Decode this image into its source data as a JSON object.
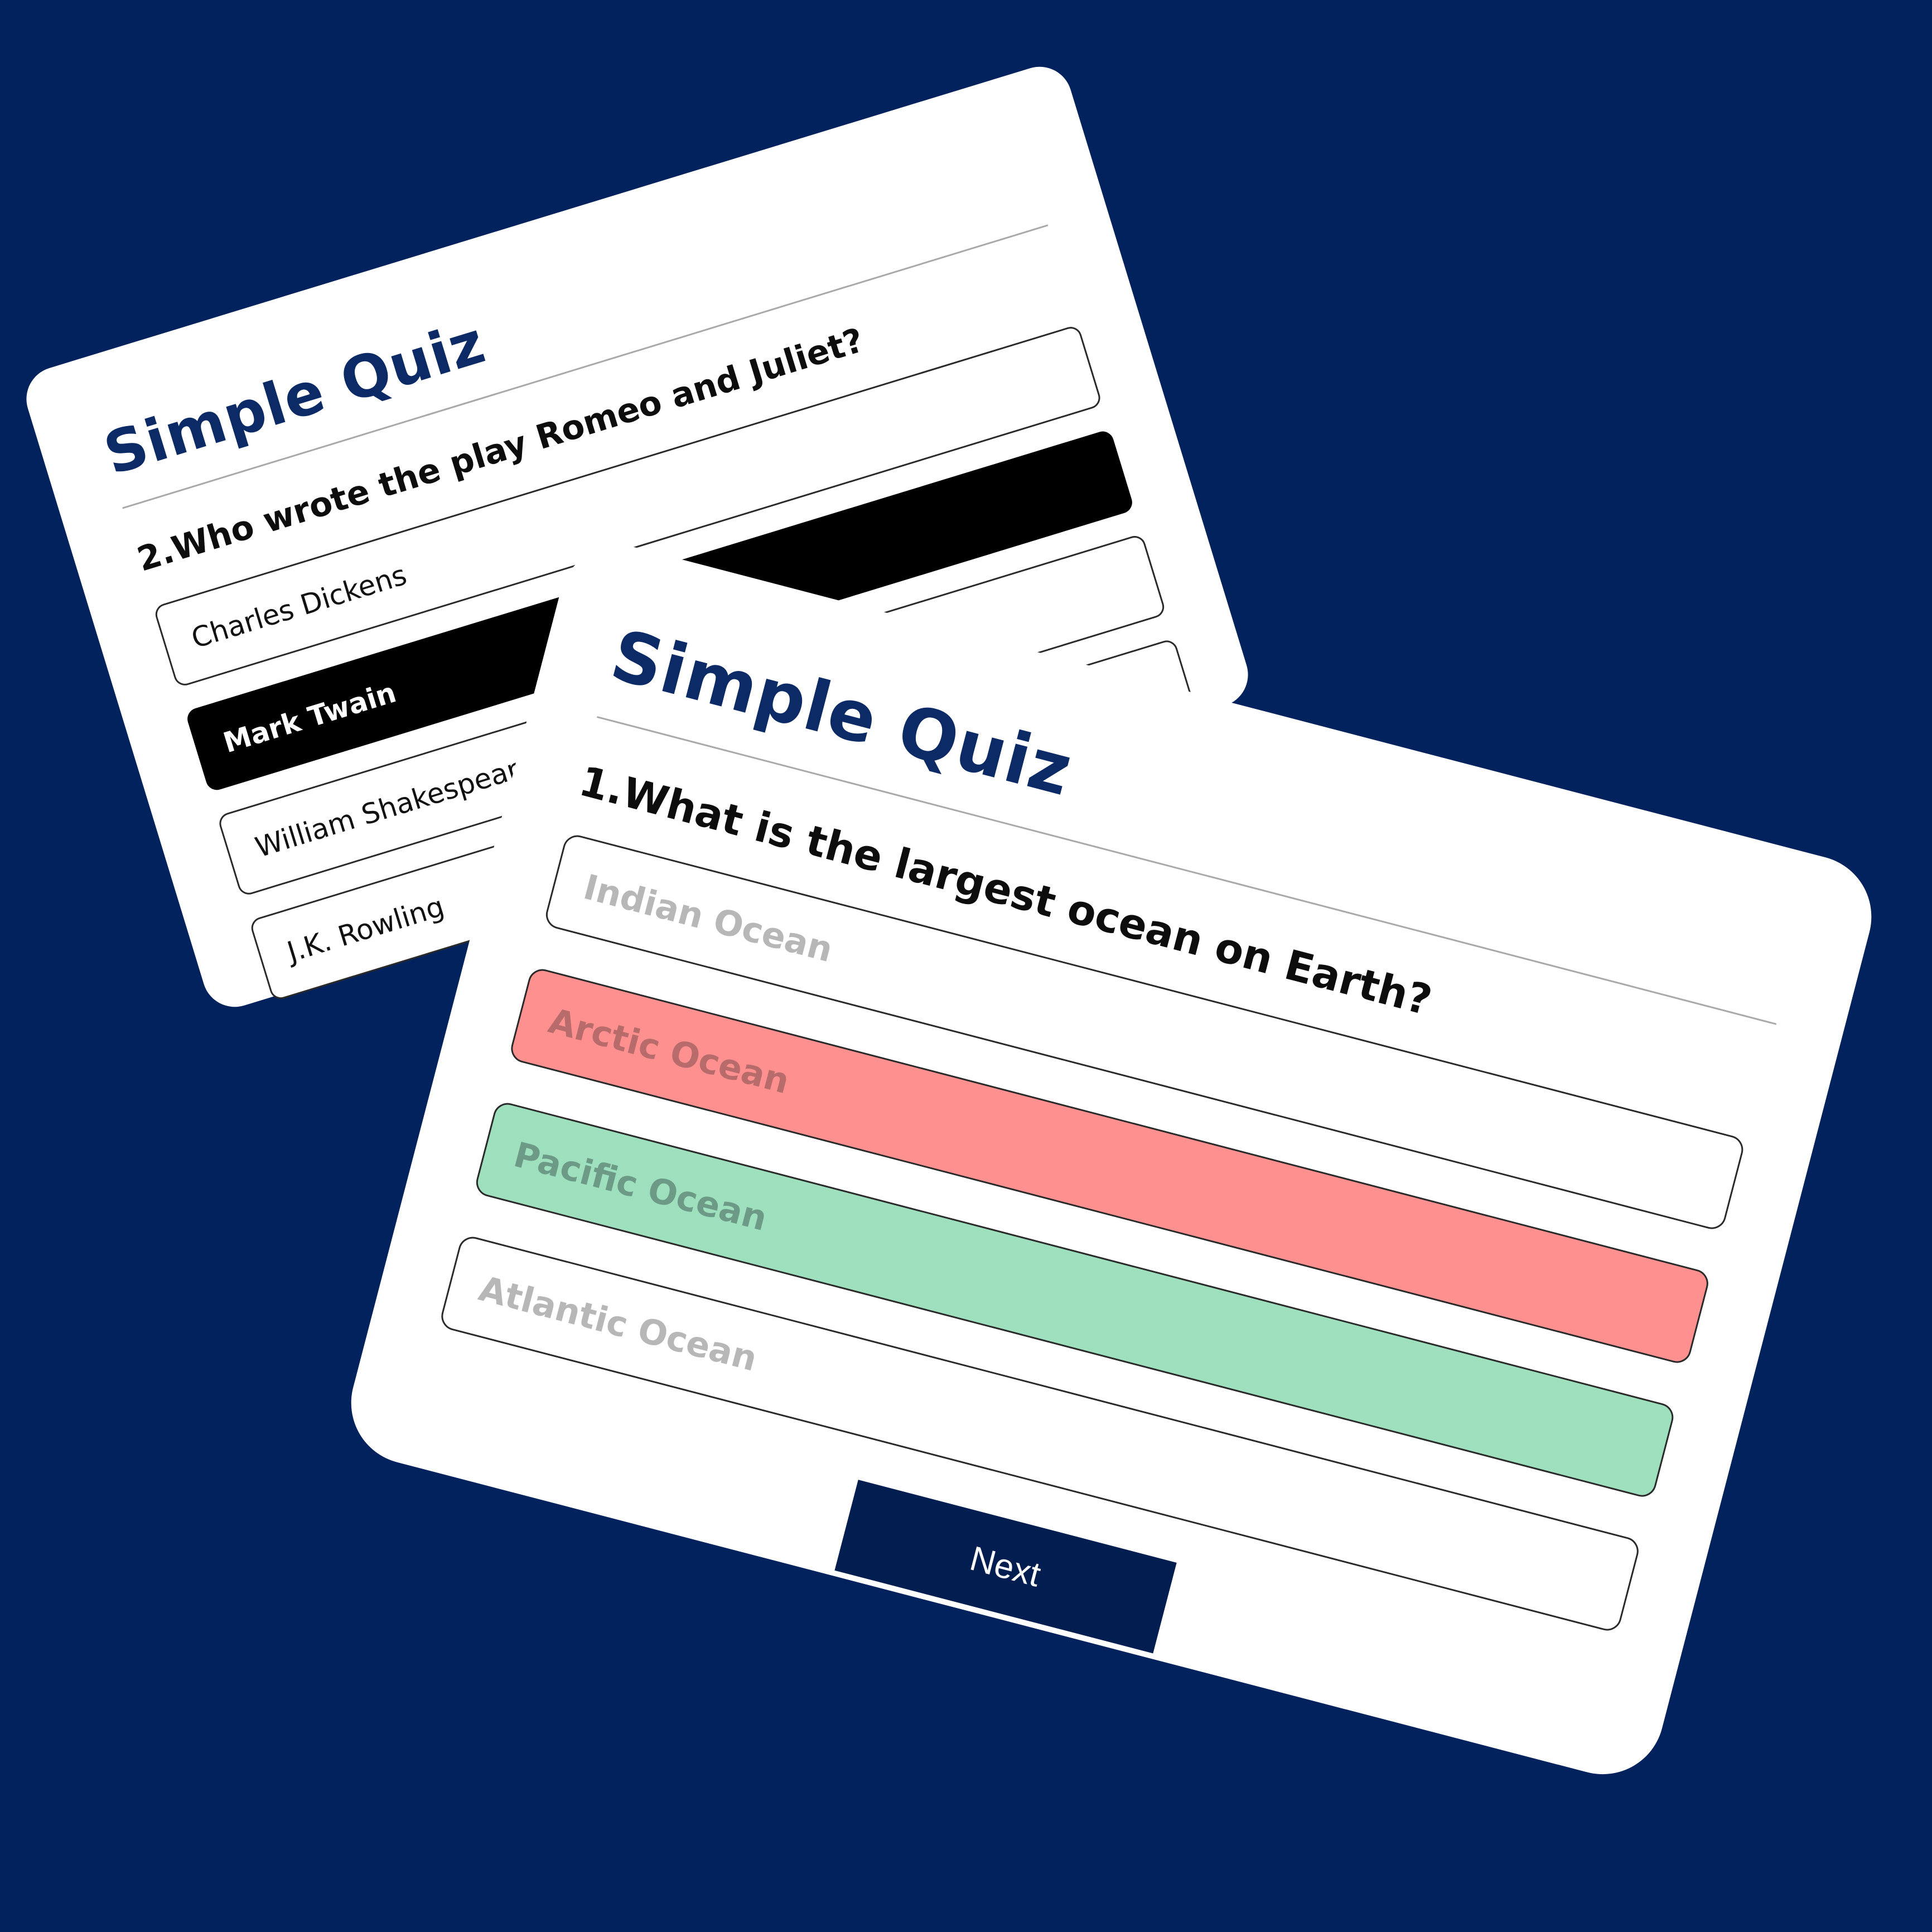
{
  "background_color": "#02225d",
  "quiz_card_back": {
    "title": "Simple Quiz",
    "question": "2.Who wrote the play Romeo and Juliet?",
    "answers": [
      {
        "label": "Charles Dickens",
        "state": "default"
      },
      {
        "label": "Mark Twain",
        "state": "selected"
      },
      {
        "label": "William Shakespeare",
        "state": "default"
      },
      {
        "label": "J.K. Rowling",
        "state": "default"
      }
    ]
  },
  "quiz_card_front": {
    "title": "Simple Quiz",
    "question": "1.What is the largest ocean on Earth?",
    "answers": [
      {
        "label": "Indian Ocean",
        "state": "disabled"
      },
      {
        "label": "Arctic Ocean",
        "state": "incorrect",
        "color": "#ff9090"
      },
      {
        "label": "Pacific Ocean",
        "state": "correct",
        "color": "#9ee0bd"
      },
      {
        "label": "Atlantic Ocean",
        "state": "disabled"
      }
    ],
    "next_label": "Next",
    "next_color": "#021d50"
  }
}
